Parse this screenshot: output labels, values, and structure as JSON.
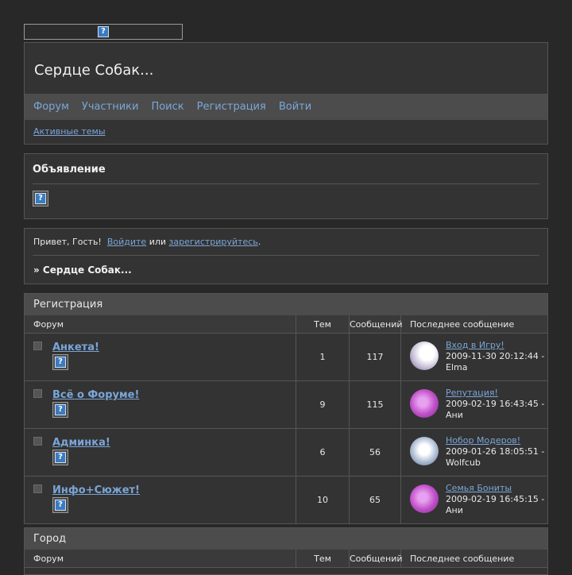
{
  "header": {
    "site_title": "Сердце Собак...",
    "nav": [
      "Форум",
      "Участники",
      "Поиск",
      "Регистрация",
      "Войти"
    ],
    "active_topics": "Активные темы"
  },
  "announcement": {
    "title": "Объявление"
  },
  "welcome": {
    "greeting": "Привет, Гость!",
    "login_link": "Войдите",
    "or": "или",
    "register_link": "зарегистрируйтесь",
    "period": ".",
    "breadcrumb": "» Сердце Собак..."
  },
  "columns": {
    "forum": "Форум",
    "topics": "Тем",
    "posts": "Сообщений",
    "last_post": "Последнее сообщение"
  },
  "categories": [
    {
      "title": "Регистрация",
      "forums": [
        {
          "name": "Анкета!",
          "topics": "1",
          "posts": "117",
          "last_title": "Вход в Игру!",
          "last_date": "2009-11-30 20:12:44 -",
          "last_author": "Elma",
          "avatar_color": "#c8c0d8"
        },
        {
          "name": "Всё о Форуме!",
          "topics": "9",
          "posts": "115",
          "last_title": "Репутация!",
          "last_date": "2009-02-19 16:43:45 -",
          "last_author": "Ани",
          "avatar_color": "#c050c8"
        },
        {
          "name": "Админка!",
          "topics": "6",
          "posts": "56",
          "last_title": "Нобор Модеров!",
          "last_date": "2009-01-26 18:05:51 -",
          "last_author": "Wolfcub",
          "avatar_color": "#a8b8d0"
        },
        {
          "name": "Инфо+Сюжет!",
          "topics": "10",
          "posts": "65",
          "last_title": "Семья Бониты",
          "last_date": "2009-02-19 16:45:15 -",
          "last_author": "Ани",
          "avatar_color": "#c050c8"
        }
      ]
    },
    {
      "title": "Город",
      "forums": []
    }
  ],
  "icons": {
    "missing_image": "?"
  }
}
